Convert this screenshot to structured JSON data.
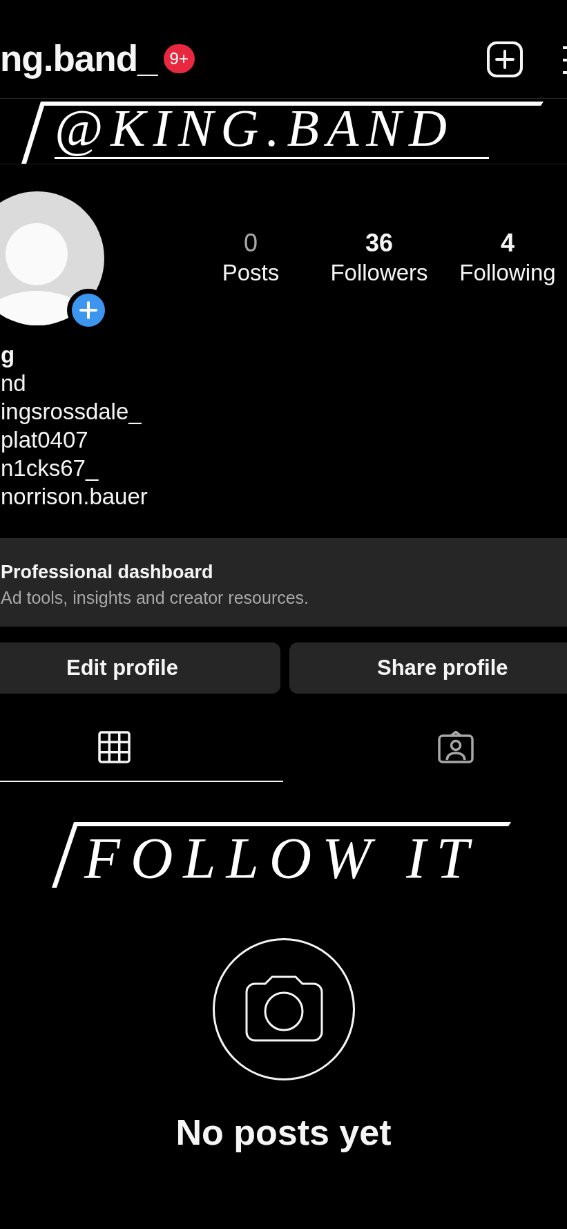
{
  "header": {
    "username": "ng.band_",
    "notification_badge": "9+"
  },
  "banner": {
    "text": "@KING.BAND"
  },
  "profile": {
    "stats": [
      {
        "value": "0",
        "label": "Posts",
        "dimmed": true
      },
      {
        "value": "36",
        "label": "Followers",
        "dimmed": false
      },
      {
        "value": "4",
        "label": "Following",
        "dimmed": false
      }
    ],
    "name": "g",
    "bio_lines": [
      "nd",
      "ingsrossdale_",
      "plat0407",
      "n1cks67_",
      "norrison.bauer"
    ]
  },
  "dashboard": {
    "title": "Professional dashboard",
    "subtitle": "Ad tools, insights and creator resources."
  },
  "buttons": [
    {
      "label": "Edit profile"
    },
    {
      "label": "Share profile"
    }
  ],
  "tabs": [
    {
      "kind": "grid",
      "selected": true
    },
    {
      "kind": "tagged",
      "selected": false
    }
  ],
  "caption": {
    "text": "FOLLOW IT"
  },
  "empty_state": {
    "message": "No posts yet"
  }
}
